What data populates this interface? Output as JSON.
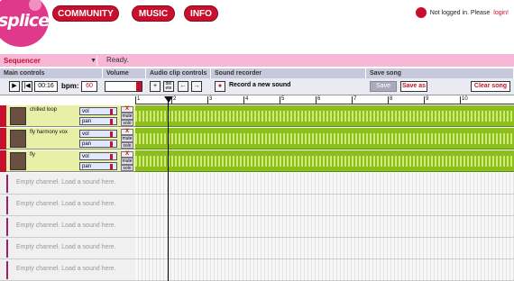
{
  "brand": {
    "logo_text": "splice"
  },
  "nav": [
    {
      "label": "COMMUNITY"
    },
    {
      "label": "MUSIC"
    },
    {
      "label": "INFO"
    }
  ],
  "login": {
    "text": "Not logged in. Please ",
    "link": "login!"
  },
  "sequencer": {
    "name": "Sequencer",
    "status": "Ready."
  },
  "sections": {
    "main": "Main controls",
    "volume": "Volume",
    "clip": "Audio clip controls",
    "recorder": "Sound recorder",
    "save": "Save song"
  },
  "controls": {
    "time": "00:16",
    "bpm_label": "bpm:",
    "bpm": "60",
    "del_label": "del ete",
    "record_label": "Record a new sound",
    "save_btn": "Save",
    "save_as_btn": "Save as",
    "clear_btn": "Clear song"
  },
  "timeline": {
    "ticks": [
      "1",
      "2",
      "3",
      "4",
      "5",
      "6",
      "7",
      "8",
      "9",
      "10"
    ]
  },
  "tracks": [
    {
      "name": "chilled loop",
      "vol": "vol",
      "pan": "pan",
      "mute": "mute",
      "solo": "solo",
      "x": "X"
    },
    {
      "name": "fly harmony vox",
      "vol": "vol",
      "pan": "pan",
      "mute": "mute",
      "solo": "solo",
      "x": "X"
    },
    {
      "name": "fly",
      "vol": "vol",
      "pan": "pan",
      "mute": "mute",
      "solo": "solo",
      "x": "X"
    }
  ],
  "empty_channels": [
    {
      "text": "Empty channel. Load a sound here."
    },
    {
      "text": "Empty channel. Load a sound here."
    },
    {
      "text": "Empty channel. Load a sound here."
    },
    {
      "text": "Empty channel. Load a sound here."
    },
    {
      "text": "Empty channel. Load a sound here."
    }
  ],
  "colors": {
    "brand_red": "#c8102e",
    "pink": "#e0388a",
    "clip_green": "#8cbf1e"
  }
}
